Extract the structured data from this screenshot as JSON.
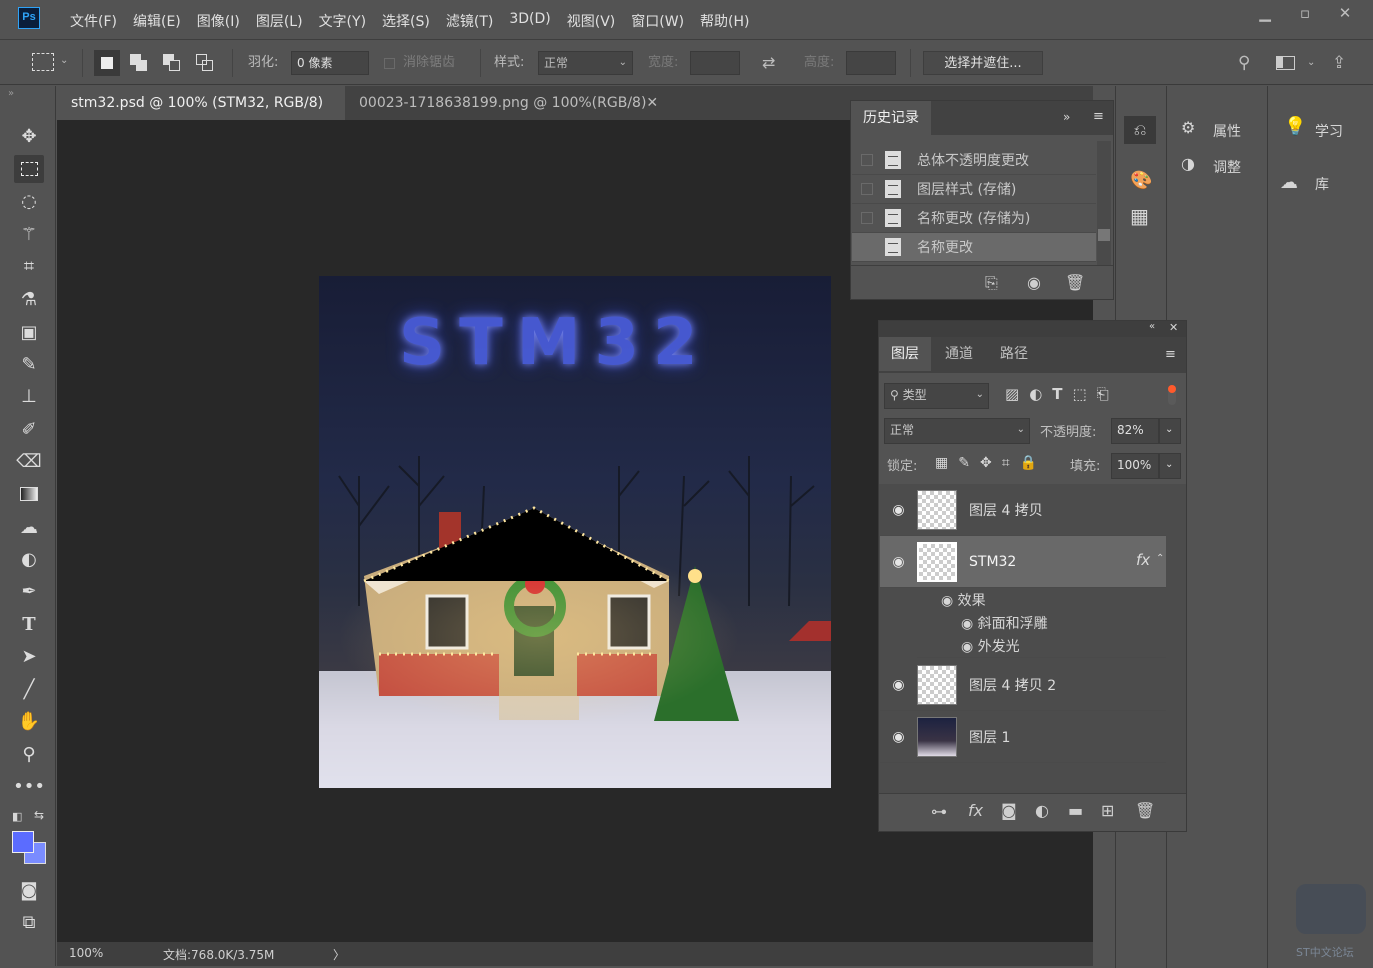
{
  "app": {
    "logo": "Ps"
  },
  "menu": [
    "文件(F)",
    "编辑(E)",
    "图像(I)",
    "图层(L)",
    "文字(Y)",
    "选择(S)",
    "滤镜(T)",
    "3D(D)",
    "视图(V)",
    "窗口(W)",
    "帮助(H)"
  ],
  "window_controls": {
    "minimize": "▁",
    "restore": "▫",
    "close": "✕"
  },
  "options": {
    "feather_label": "羽化:",
    "feather_value": "0 像素",
    "antialias_label": "消除锯齿",
    "style_label": "样式:",
    "style_value": "正常",
    "width_label": "宽度:",
    "height_label": "高度:",
    "select_mask_button": "选择并遮住..."
  },
  "tabs": [
    {
      "label": "stm32.psd @ 100% (STM32, RGB/8) *",
      "close": "✕",
      "active": true
    },
    {
      "label": "00023-1718638199.png @ 100%(RGB/8)",
      "close": "✕",
      "active": false
    }
  ],
  "status": {
    "zoom": "100%",
    "doc": "文档:768.0K/3.75M",
    "arrow": "〉"
  },
  "canvas": {
    "text": "STM32"
  },
  "history": {
    "title": "历史记录",
    "items": [
      "总体不透明度更改",
      "图层样式 (存储)",
      "名称更改 (存储为)",
      "名称更改"
    ]
  },
  "right_panels": {
    "properties": "属性",
    "adjustments": "调整",
    "learn": "学习",
    "libraries": "库"
  },
  "layers_panel": {
    "tabs": [
      "图层",
      "通道",
      "路径"
    ],
    "filter_label": "类型",
    "blend_mode": "正常",
    "opacity_label": "不透明度:",
    "opacity_value": "82%",
    "lock_label": "锁定:",
    "fill_label": "填充:",
    "fill_value": "100%",
    "fx": "fx",
    "layers": [
      {
        "name": "图层 4 拷贝"
      },
      {
        "name": "STM32"
      },
      {
        "name": "图层 4 拷贝 2"
      },
      {
        "name": "图层 1"
      }
    ],
    "effects_label": "效果",
    "effects": [
      "斜面和浮雕",
      "外发光"
    ]
  },
  "watermark": "ST中文论坛",
  "colors": {
    "accent": "#2fa3f7",
    "foreground": "#5b6cff",
    "background": "#7a8cff"
  }
}
